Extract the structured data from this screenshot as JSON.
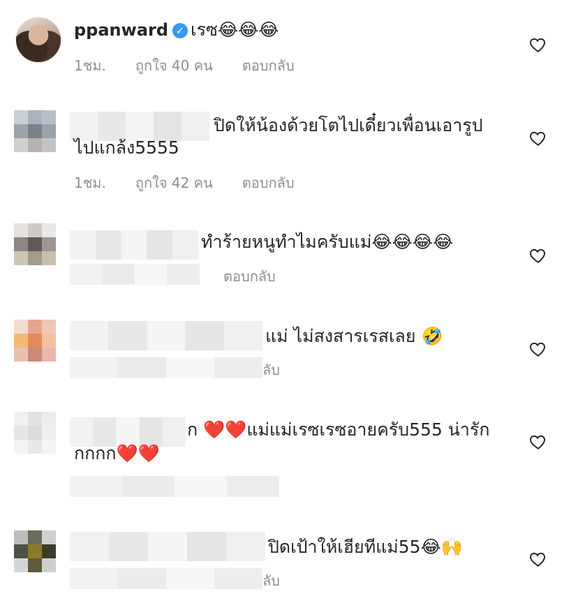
{
  "comments": [
    {
      "username": "ppanward",
      "text": "เรซ😂😂😂",
      "time": "1ชม.",
      "likes": "ถูกใจ 40 คน",
      "reply": "ตอบกลับ"
    },
    {
      "username": "",
      "text_line1": "ปิดให้น้องด้วยโตไปเดี๋ยวเพื่อนเอารูป",
      "text_line2": "ไปแกล้ง5555",
      "time": "1ชม.",
      "likes": "ถูกใจ 42 คน",
      "reply": "ตอบกลับ"
    },
    {
      "username": "",
      "text": "ทำร้ายหนูทำไมครับแม่😂😂😂😂",
      "reply": "ตอบกลับ"
    },
    {
      "username": "",
      "text": "แม่ ไม่สงสารเรสเลย 🤣",
      "reply_fragment": "ลับ"
    },
    {
      "username": "",
      "text_line1": "ก ❤️❤️แม่แม่เรซเรซอายครับ555 น่ารัก",
      "text_line2": "กกกก❤️❤️"
    },
    {
      "username": "",
      "text": "ปิดเป้าให้เฮียทีแม่55😂🙌",
      "reply_fragment": "ลับ"
    }
  ],
  "icons": {
    "like": "heart-outline-icon",
    "verified": "verified-badge-icon"
  },
  "colors": {
    "text": "#262626",
    "meta": "#8e8e8e",
    "verified": "#3897f0"
  }
}
